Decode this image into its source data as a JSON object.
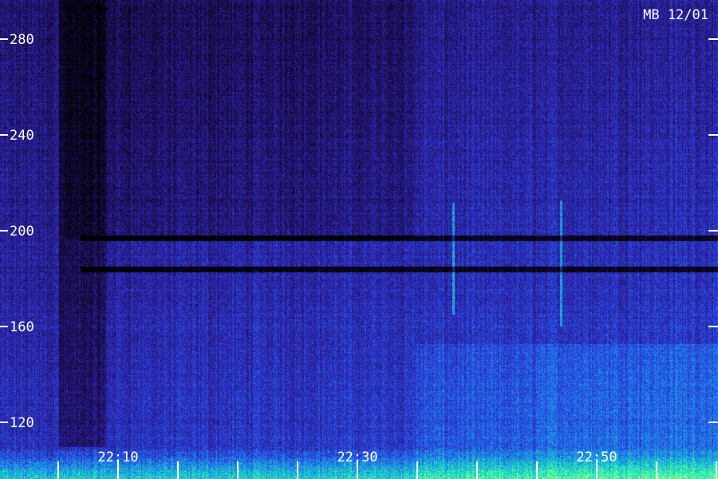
{
  "chart_data": {
    "type": "heatmap",
    "title": "MB 12/01",
    "xlabel": "",
    "ylabel": "",
    "ylim": [
      105,
      290
    ],
    "xlim": [
      "22:06",
      "22:55"
    ],
    "y_ticks": [
      120,
      160,
      200,
      240,
      280
    ],
    "x_ticks": [
      "22:10",
      "22:30",
      "22:50"
    ],
    "x_minor_tick_count": 12,
    "colormap": [
      "#000000",
      "#140a3a",
      "#2a1a8a",
      "#2c3ad8",
      "#1e7ef0",
      "#19c8c8",
      "#35ffb0",
      "#d4ff5a"
    ],
    "features": [
      {
        "kind": "horizontal-dark-band",
        "freq": 197
      },
      {
        "kind": "horizontal-dark-band",
        "freq": 184
      },
      {
        "kind": "vertical-bright-line",
        "time": "22:38",
        "freq_range": [
          165,
          212
        ]
      },
      {
        "kind": "vertical-bright-line",
        "time": "22:47",
        "freq_range": [
          160,
          213
        ]
      },
      {
        "kind": "vertical-dark-column",
        "time": "22:07"
      }
    ]
  }
}
